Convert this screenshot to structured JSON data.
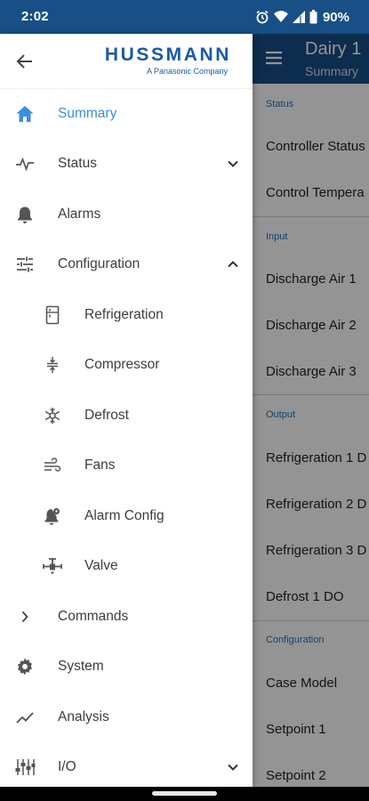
{
  "status_bar": {
    "time": "2:02",
    "battery_percent": "90%",
    "icons": [
      "alarm-icon",
      "wifi-icon",
      "signal-icon",
      "battery-icon"
    ]
  },
  "app": {
    "title": "Dairy 1",
    "subtitle": "Summary",
    "sections": [
      {
        "header": "Status",
        "rows": [
          "Controller Status",
          "Control Tempera"
        ]
      },
      {
        "header": "Input",
        "rows": [
          "Discharge Air 1",
          "Discharge Air 2",
          "Discharge Air 3"
        ]
      },
      {
        "header": "Output",
        "rows": [
          "Refrigeration 1 D",
          "Refrigeration 2 D",
          "Refrigeration 3 D",
          "Defrost 1 DO"
        ]
      },
      {
        "header": "Configuration",
        "rows": [
          "Case Model",
          "Setpoint 1",
          "Setpoint 2"
        ]
      }
    ]
  },
  "drawer": {
    "logo": {
      "name": "HUSSMANN",
      "tagline": "A Panasonic Company"
    },
    "items": [
      {
        "label": "Summary",
        "icon": "home-icon",
        "active": true
      },
      {
        "label": "Status",
        "icon": "pulse-icon",
        "expandable": true,
        "expanded": false
      },
      {
        "label": "Alarms",
        "icon": "bell-icon"
      },
      {
        "label": "Configuration",
        "icon": "sliders-icon",
        "expandable": true,
        "expanded": true
      },
      {
        "label": "Refrigeration",
        "icon": "refrigerator-icon"
      },
      {
        "label": "Compressor",
        "icon": "compressor-icon"
      },
      {
        "label": "Defrost",
        "icon": "snowflake-icon"
      },
      {
        "label": "Fans",
        "icon": "fan-icon"
      },
      {
        "label": "Alarm Config",
        "icon": "alarm-config-icon"
      },
      {
        "label": "Valve",
        "icon": "valve-icon"
      },
      {
        "label": "Commands",
        "icon": "chevron-right-icon"
      },
      {
        "label": "System",
        "icon": "gear-icon"
      },
      {
        "label": "Analysis",
        "icon": "trend-icon"
      },
      {
        "label": "I/O",
        "icon": "io-icon",
        "expandable": true,
        "expanded": false
      }
    ]
  },
  "colors": {
    "primary": "#184f87",
    "accent": "#3a8ee0",
    "logo": "#1a5aa8"
  }
}
